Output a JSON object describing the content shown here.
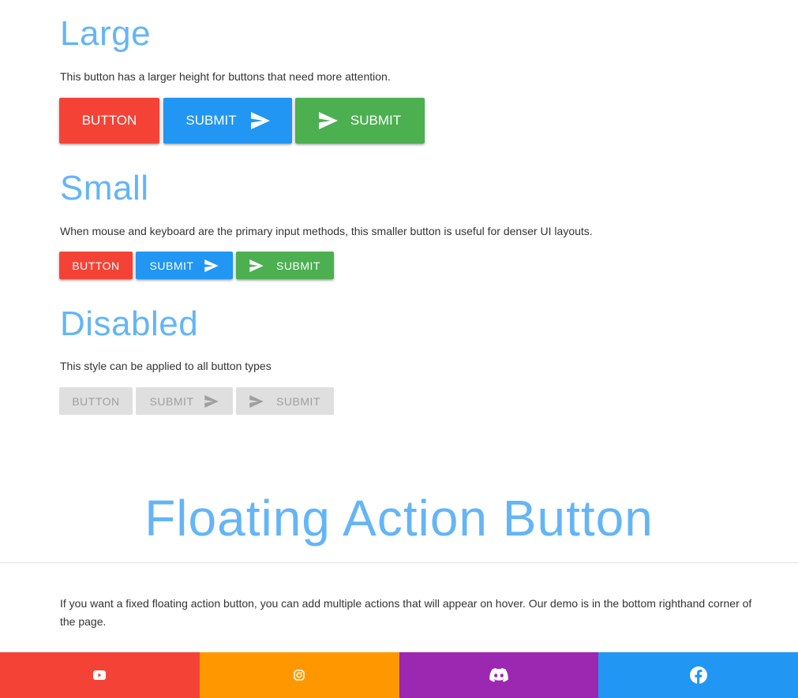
{
  "large": {
    "title": "Large",
    "description": "This button has a larger height for buttons that need more attention.",
    "buttons": [
      "BUTTON",
      "SUBMIT",
      "SUBMIT"
    ]
  },
  "small": {
    "title": "Small",
    "description": "When mouse and keyboard are the primary input methods, this smaller button is useful for denser UI layouts.",
    "buttons": [
      "BUTTON",
      "SUBMIT",
      "SUBMIT"
    ]
  },
  "disabled": {
    "title": "Disabled",
    "description": "This style can be applied to all button types",
    "buttons": [
      "BUTTON",
      "SUBMIT",
      "SUBMIT"
    ]
  },
  "fab": {
    "title": "Floating Action Button",
    "description": "If you want a fixed floating action button, you can add multiple actions that will appear on hover. Our demo is in the bottom righthand corner of the page."
  },
  "footer": {
    "items": [
      {
        "icon": "youtube-icon",
        "color": "#f44336"
      },
      {
        "icon": "instagram-icon",
        "color": "#ff9800"
      },
      {
        "icon": "discord-icon",
        "color": "#9c27b0"
      },
      {
        "icon": "facebook-icon",
        "color": "#2196f3"
      }
    ]
  },
  "colors": {
    "red": "#f44336",
    "blue": "#2196f3",
    "green": "#4caf50",
    "disabled": "#dfdfdf",
    "heading": "#64b5f6"
  }
}
